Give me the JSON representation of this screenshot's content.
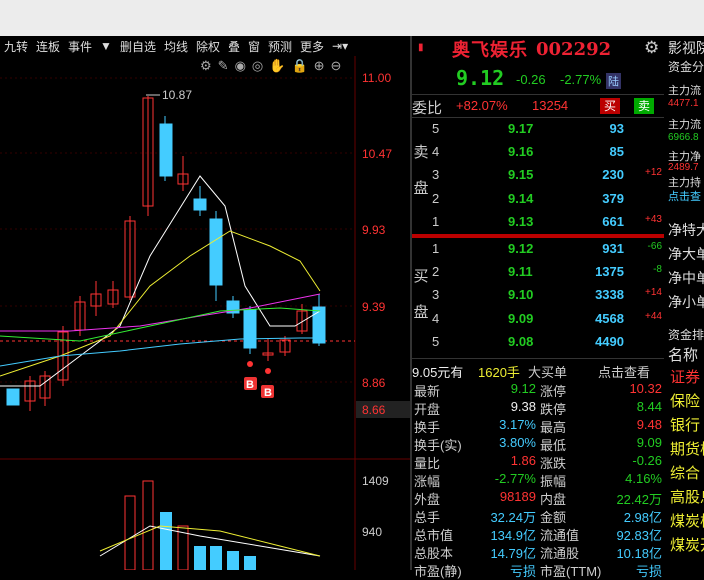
{
  "toolbar": {
    "items": [
      "九转",
      "连板",
      "事件",
      "▼",
      "删自选",
      "均线",
      "除权",
      "叠",
      "窗",
      "预测",
      "更多"
    ]
  },
  "chart": {
    "price_axis": [
      "11.00",
      "10.47",
      "9.93",
      "9.39",
      "8.86",
      "8.66"
    ],
    "volume_axis": [
      "1409",
      "940"
    ],
    "high_label": "10.87",
    "markers": [
      "B",
      "B"
    ]
  },
  "stock": {
    "name": "奥飞娱乐",
    "code": "002292",
    "price": "9.12",
    "change": "-0.26",
    "change_pct": "-2.77%",
    "tag": "陆"
  },
  "weibi": {
    "label": "委比",
    "value": "+82.07%",
    "diff": "13254",
    "buy": "买",
    "sell": "卖"
  },
  "sell_side_label": [
    "卖",
    "盘"
  ],
  "buy_side_label": [
    "买",
    "盘"
  ],
  "asks": [
    {
      "level": "5",
      "price": "9.17",
      "vol": "93",
      "delta": ""
    },
    {
      "level": "4",
      "price": "9.16",
      "vol": "85",
      "delta": ""
    },
    {
      "level": "3",
      "price": "9.15",
      "vol": "230",
      "delta": "+12"
    },
    {
      "level": "2",
      "price": "9.14",
      "vol": "379",
      "delta": ""
    },
    {
      "level": "1",
      "price": "9.13",
      "vol": "661",
      "delta": "+43"
    }
  ],
  "bids": [
    {
      "level": "1",
      "price": "9.12",
      "vol": "931",
      "delta": "-66"
    },
    {
      "level": "2",
      "price": "9.11",
      "vol": "1375",
      "delta": "-8"
    },
    {
      "level": "3",
      "price": "9.10",
      "vol": "3338",
      "delta": "+14"
    },
    {
      "level": "4",
      "price": "9.09",
      "vol": "4568",
      "delta": "+44"
    },
    {
      "level": "5",
      "price": "9.08",
      "vol": "4490",
      "delta": ""
    }
  ],
  "big_order": {
    "price": "9.05元有",
    "vol": "1620手",
    "label": "大买单",
    "link": "点击查看"
  },
  "stats": [
    {
      "l1": "最新",
      "v1": "9.12",
      "l2": "涨停",
      "v2": "10.32"
    },
    {
      "l1": "开盘",
      "v1": "9.38",
      "l2": "跌停",
      "v2": "8.44"
    },
    {
      "l1": "换手",
      "v1": "3.17%",
      "l2": "最高",
      "v2": "9.48"
    },
    {
      "l1": "换手(实)",
      "v1": "3.80%",
      "l2": "最低",
      "v2": "9.09"
    },
    {
      "l1": "量比",
      "v1": "1.86",
      "l2": "涨跌",
      "v2": "-0.26"
    },
    {
      "l1": "涨幅",
      "v1": "-2.77%",
      "l2": "振幅",
      "v2": "4.16%"
    },
    {
      "l1": "外盘",
      "v1": "98189",
      "l2": "内盘",
      "v2": "22.42万"
    },
    {
      "l1": "总手",
      "v1": "32.24万",
      "l2": "金额",
      "v2": "2.98亿"
    },
    {
      "l1": "总市值",
      "v1": "134.9亿",
      "l2": "流通值",
      "v2": "92.83亿"
    },
    {
      "l1": "总股本",
      "v1": "14.79亿",
      "l2": "流通股",
      "v2": "10.18亿"
    },
    {
      "l1": "市盈(静)",
      "v1": "亏损",
      "l2": "市盈(TTM)",
      "v2": "亏损"
    }
  ],
  "right_panel": {
    "title": "影视院",
    "subtitle": "资金分",
    "items": [
      "主力流",
      "4477.1",
      "主力流",
      "6966.8",
      "主力净",
      "2489.7",
      "主力持",
      "点击查"
    ],
    "net": [
      "净特大",
      "净大单",
      "净中单",
      "净小单"
    ],
    "rank_title": "资金排",
    "col": "名称",
    "sectors": [
      "证券",
      "保险",
      "银行",
      "期货板",
      "综合",
      "高股息",
      "煤炭板",
      "煤炭开"
    ]
  },
  "colors": {
    "up": "#ff3333",
    "down": "#22cc22",
    "bg": "#000000",
    "accent": "#4cc4ff"
  }
}
